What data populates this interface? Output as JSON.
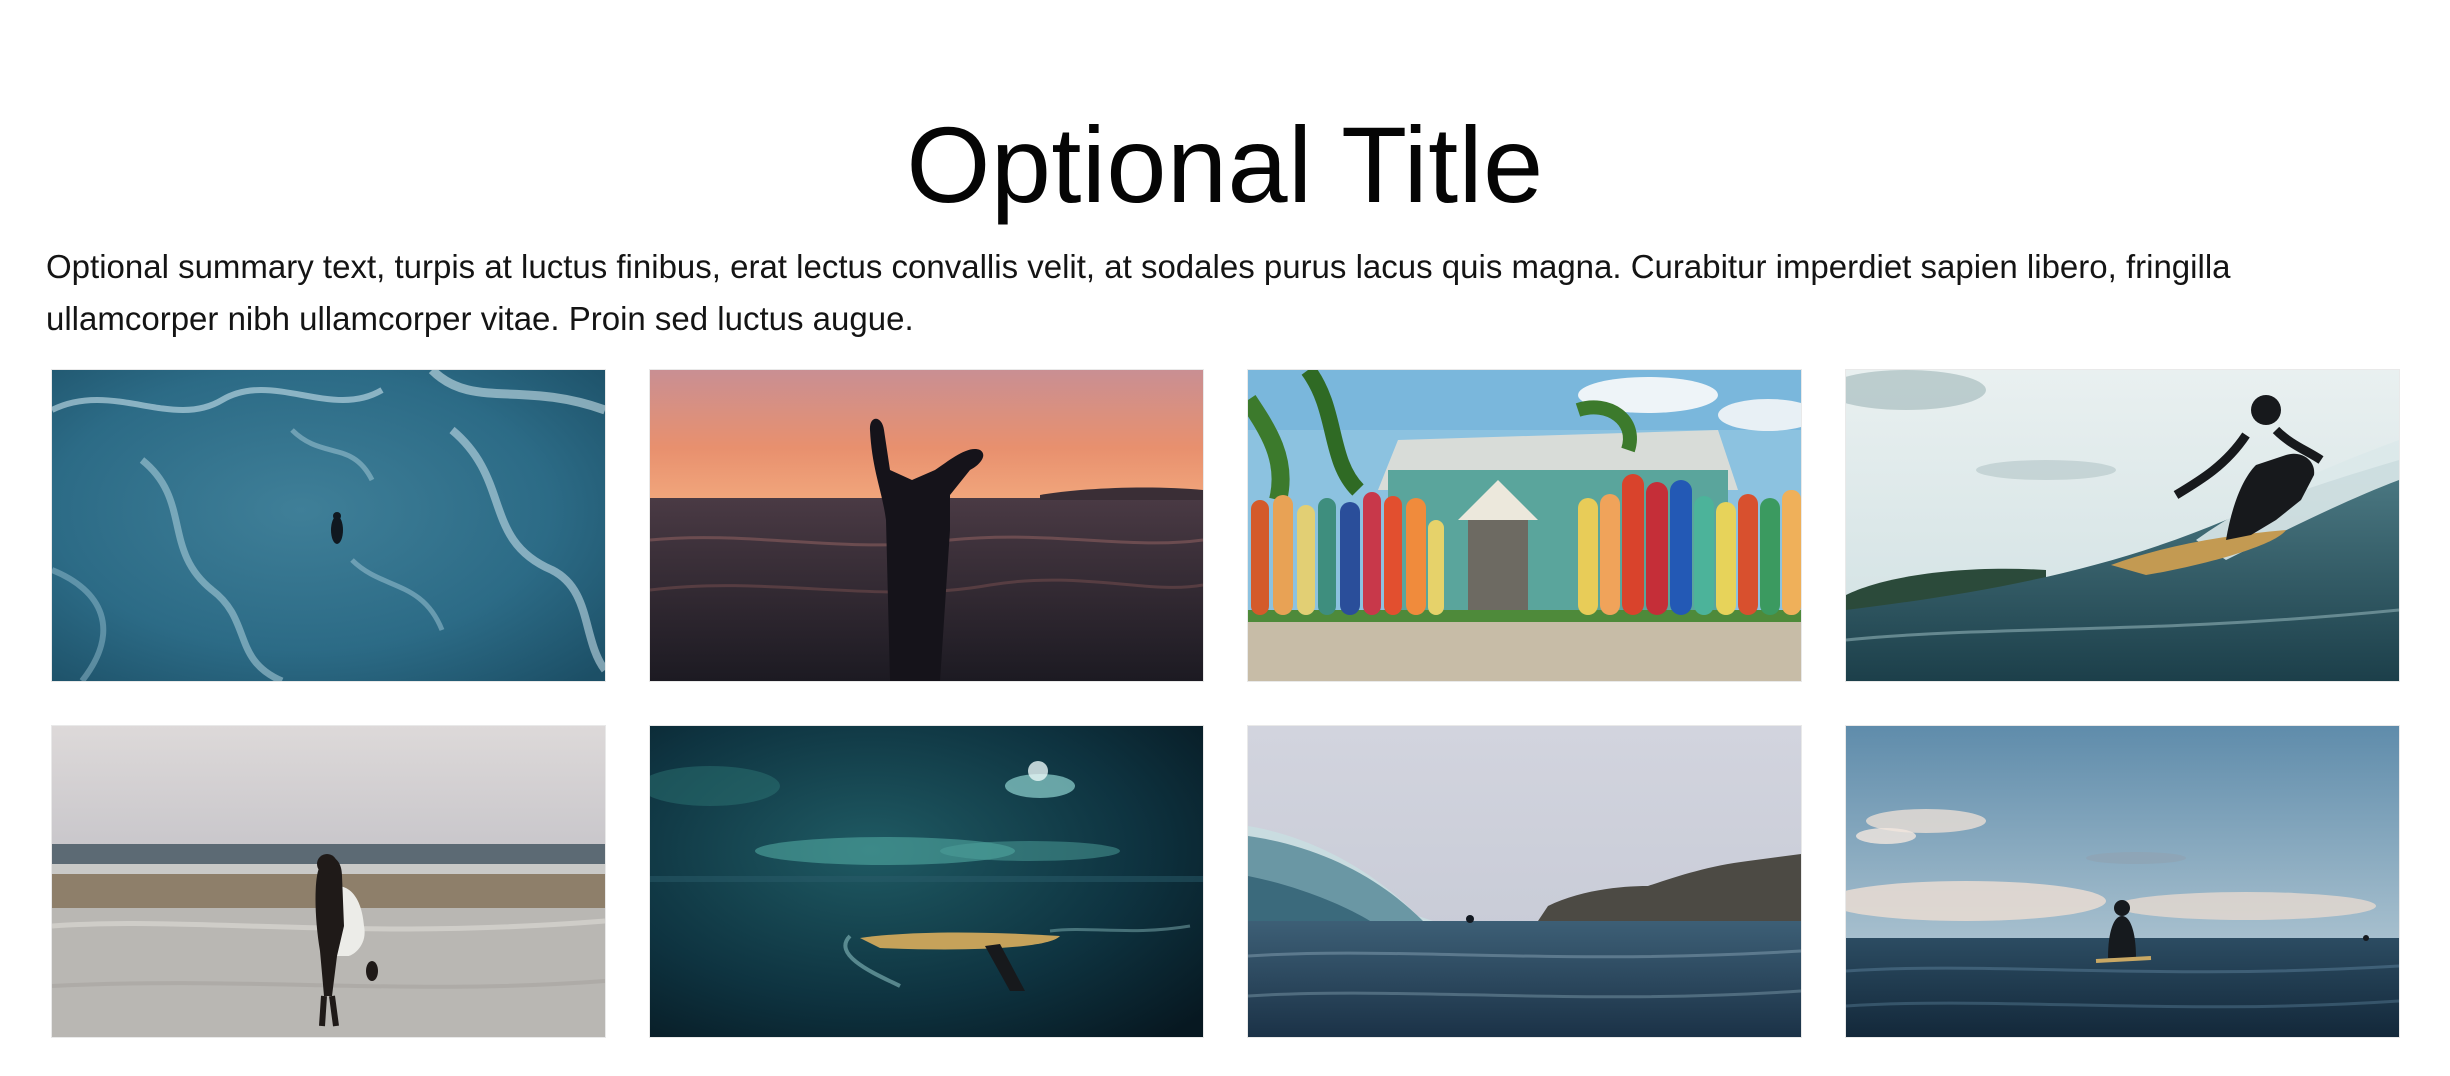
{
  "page": {
    "title": "Optional Title",
    "summary": "Optional summary text, turpis at luctus finibus, erat lectus convallis velit, at sodales purus lacus quis magna. Curabitur imperdiet sapien libero, fringilla ullamcorper nibh ullamcorper vitae. Proin sed luctus augue."
  },
  "gallery": {
    "images": [
      {
        "name": "aerial-surfer-ocean"
      },
      {
        "name": "sunset-shaka-hand"
      },
      {
        "name": "surfboard-fence-house"
      },
      {
        "name": "surfer-riding-wave"
      },
      {
        "name": "woman-carrying-surfboard-beach"
      },
      {
        "name": "underwater-surfboard-night"
      },
      {
        "name": "wave-and-cliffs"
      },
      {
        "name": "surfer-waiting-in-water"
      }
    ]
  }
}
